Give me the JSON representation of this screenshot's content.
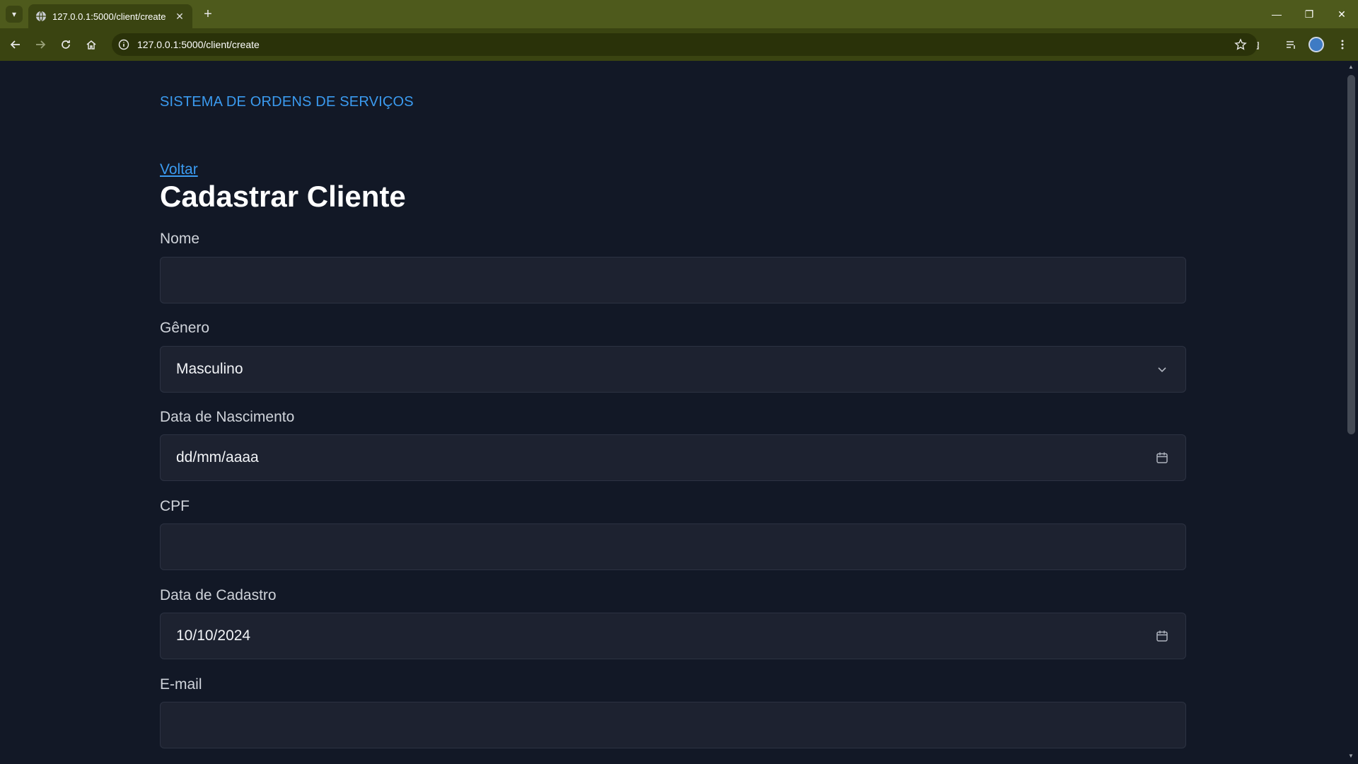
{
  "browser": {
    "tab_title": "127.0.0.1:5000/client/create",
    "url": "127.0.0.1:5000/client/create"
  },
  "page": {
    "brand": "SISTEMA DE ORDENS DE SERVIÇOS",
    "back_link": "Voltar",
    "title": "Cadastrar Cliente"
  },
  "form": {
    "nome": {
      "label": "Nome",
      "value": ""
    },
    "genero": {
      "label": "Gênero",
      "value": "Masculino"
    },
    "nascimento": {
      "label": "Data de Nascimento",
      "value": "dd/mm/aaaa"
    },
    "cpf": {
      "label": "CPF",
      "value": ""
    },
    "cadastro": {
      "label": "Data de Cadastro",
      "value": "10/10/2024"
    },
    "email": {
      "label": "E-mail",
      "value": ""
    }
  },
  "colors": {
    "background": "#121826",
    "link": "#3b9bf0",
    "input_background": "#1d2230",
    "browser_frame": "#4e5a1c"
  }
}
